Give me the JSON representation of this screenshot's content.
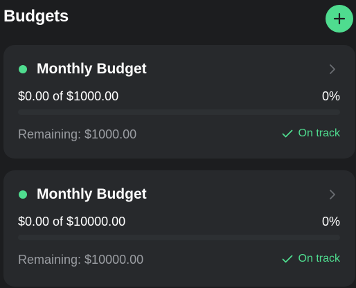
{
  "header": {
    "title": "Budgets",
    "add_icon": "plus-icon"
  },
  "colors": {
    "background": "#1c1d1f",
    "card": "#27292c",
    "accent": "#4fdc8f",
    "muted_text": "#9a9da2"
  },
  "budgets": [
    {
      "name": "Monthly Budget",
      "amount": "$0.00 of $1000.00",
      "percent": "0%",
      "progress": 0,
      "remaining": "Remaining: $1000.00",
      "status": "On track"
    },
    {
      "name": "Monthly Budget",
      "amount": "$0.00 of $10000.00",
      "percent": "0%",
      "progress": 0,
      "remaining": "Remaining: $10000.00",
      "status": "On track"
    }
  ]
}
